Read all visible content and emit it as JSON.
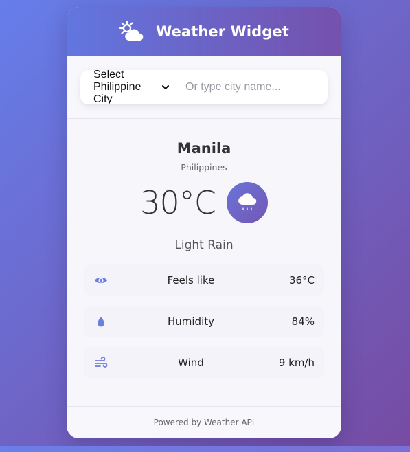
{
  "header": {
    "title": "Weather Widget",
    "icon": "sun-cloud-icon"
  },
  "search": {
    "select_value": "Select Philippine City",
    "input_placeholder": "Or type city name..."
  },
  "location": {
    "city": "Manila",
    "country": "Philippines"
  },
  "current": {
    "temperature": "30°C",
    "condition": "Light Rain",
    "icon": "cloud-rain-icon"
  },
  "details": [
    {
      "icon": "eye-icon",
      "label": "Feels like",
      "value": "36°C"
    },
    {
      "icon": "droplet-icon",
      "label": "Humidity",
      "value": "84%"
    },
    {
      "icon": "wind-icon",
      "label": "Wind",
      "value": "9 km/h"
    }
  ],
  "footer": {
    "text": "Powered by Weather API"
  },
  "colors": {
    "accent": "#667eea",
    "accent_dark": "#764ba2",
    "icon_blue": "#6a7fe0"
  }
}
